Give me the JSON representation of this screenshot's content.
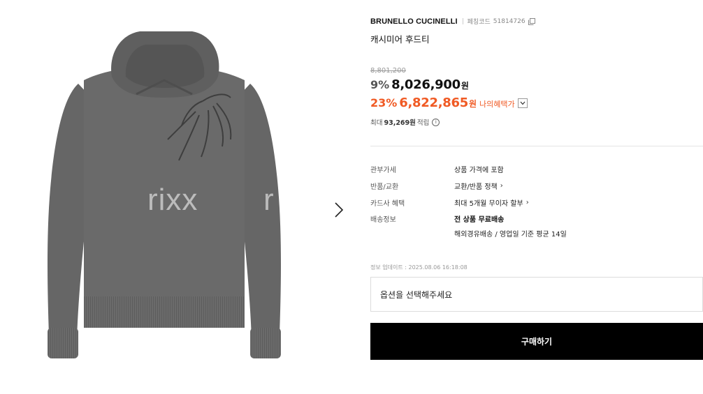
{
  "gallery": {
    "watermark_1": "rixx",
    "watermark_2": "r"
  },
  "product": {
    "brand": "BRUNELLO CUCINELLI",
    "code_label": "페칭코드",
    "code_value": "51814726",
    "name": "캐시미어 후드티"
  },
  "pricing": {
    "original_price": "8,801,200",
    "discount_rate": "9%",
    "sale_price": "8,026,900",
    "currency_unit": "원",
    "benefit_rate": "23%",
    "benefit_price": "6,822,865",
    "benefit_label": "나의혜택가",
    "points_prefix": "최대",
    "points_value": "93,269원",
    "points_suffix": "적립",
    "accent_color": "#f05a24"
  },
  "specs": [
    {
      "label": "관부가세",
      "value": "상품 가격에 포함"
    },
    {
      "label": "반품/교환",
      "value": "교환/반품 정책"
    },
    {
      "label": "카드사 혜택",
      "value": "최대 5개월 무이자 할부"
    },
    {
      "label": "배송정보",
      "value": "전 상품 무료배송"
    },
    {
      "label": "",
      "value": "해외경유배송 / 영업일 기준 평균 14일"
    }
  ],
  "update_info": "정보 업데이트 : 2025.08.06 16:18:08",
  "option_placeholder": "옵션을 선택해주세요",
  "buy_label": "구매하기"
}
